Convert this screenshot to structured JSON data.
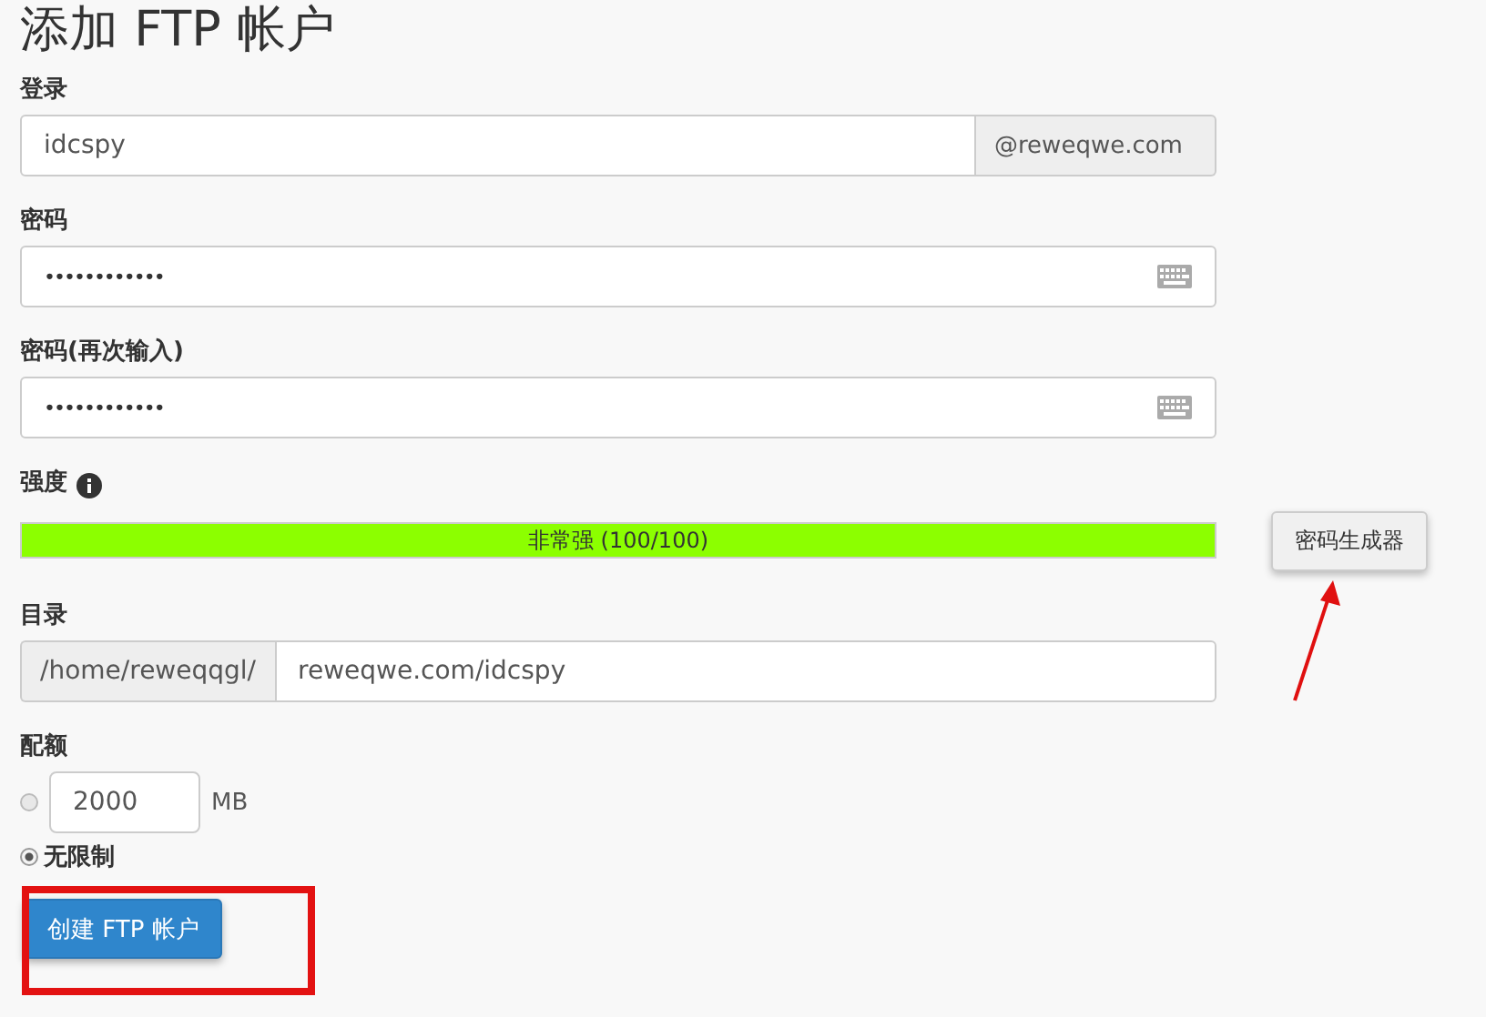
{
  "title": "添加 FTP 帐户",
  "login": {
    "label": "登录",
    "value": "idcspy",
    "domain": "@reweqwe.com"
  },
  "password": {
    "label": "密码",
    "value": "••••••••••••"
  },
  "password_again": {
    "label": "密码(再次输入)",
    "value": "••••••••••••"
  },
  "strength": {
    "label": "强度",
    "level": 1,
    "reading": "非常强 (100/100)",
    "generator_button": "密码生成器"
  },
  "directory": {
    "label": "目录",
    "prefix": "/home/reweqqgl/",
    "value": "reweqwe.com/idcspy"
  },
  "quota": {
    "label": "配额",
    "options": [
      {
        "kind": "limit",
        "selected": false,
        "value": "2000",
        "unit": "MB"
      },
      {
        "kind": "unlimited",
        "selected": true,
        "label": "无限制"
      }
    ]
  },
  "submit_button": "创建 FTP 帐户"
}
